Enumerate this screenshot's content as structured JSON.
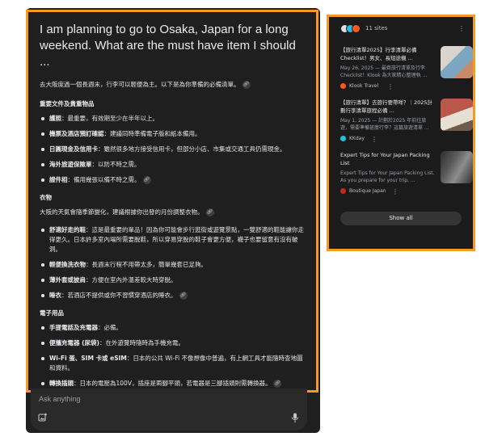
{
  "question": "I am planning to go to Osaka, Japan for a long weekend. What are the must have item I should ...",
  "intro": "去大阪度過一個長週末，行李可以輕便為主。以下是為你準備的必備清單。",
  "sections": {
    "documents": {
      "heading": "重要文件及貴重物品",
      "items": [
        {
          "term": "護照",
          "text": "：最重要，有效期至少在半年以上。"
        },
        {
          "term": "機票及酒店預訂確認",
          "text": "：建議同時準備電子版和紙本備用。"
        },
        {
          "term": "日圓現金及信用卡",
          "text": "：雖然很多地方接受信用卡，但部分小店、市集或交通工具仍需現金。"
        },
        {
          "term": "海外旅遊保險單",
          "text": "：以防不時之需。"
        },
        {
          "term": "證件相",
          "text": "：備用幾張以備不時之需。"
        }
      ]
    },
    "clothing": {
      "heading": "衣物",
      "intro": "大阪的天氣會隨季節變化，建議根據你出發的月份調整衣物。",
      "items": [
        {
          "term": "舒適好走的鞋",
          "text": "：這是最重要的單品！因為你可能會步行逛街或遊覽景點，一雙舒適的鞋能讓你走得更久。日本許多室內場所需要脫鞋，所以穿易穿脫的鞋子會更方便，襪子也要留意有沒有破洞。"
        },
        {
          "term": "輕便換洗衣物",
          "text": "：長週末行程不用帶太多，簡單幾套已足夠。"
        },
        {
          "term": "薄外套或披肩",
          "text": "：方便在室內外溫差較大時穿脫。"
        },
        {
          "term": "睡衣",
          "text": "：若酒店不提供或你不習慣穿酒店的睡衣。"
        }
      ]
    },
    "electronics": {
      "heading": "電子用品",
      "items": [
        {
          "term": "手提電話及充電器",
          "text": "：必備。"
        },
        {
          "term": "便攜充電器 (尿袋)",
          "text": "：在外遊覽時隨時為手機充電。"
        },
        {
          "term": "Wi-Fi 蛋、SIM 卡或 eSIM",
          "text": "：日本的公共 Wi-Fi 不像想像中普遍，有上網工具才能隨時查地圖和資料。"
        },
        {
          "term": "轉換插頭",
          "text": "：日本的電壓為100V，插座是兩腳平頭，若電器是三腳插頭則需轉換器。"
        }
      ]
    }
  },
  "input": {
    "placeholder": "Ask anything"
  },
  "sources": {
    "count_label": "11 sites",
    "items": [
      {
        "title": "【旅行清單2025】行李清單必備Checklist！男女、長短途機 ...",
        "snippet": "May 26, 2025 — 最齊旅行清單及行李Checklist！Klook 為大家精心整理執 ...",
        "site": "Klook Travel",
        "site_color": "#ff5722",
        "thumb_colors": [
          "#d9d4cc",
          "#7aa6c2",
          "#c98a6a"
        ]
      },
      {
        "title": "【旅行清單】去旅行要帶咩？｜2025計劃行李清單旅程必備 ...",
        "snippet": "May 1, 2025 — 計劃於2025 年前往旅遊，需要準備甚麼行李？這篇旅遊清單 ...",
        "site": "KKday",
        "site_color": "#26bfe0",
        "thumb_colors": [
          "#b9574a",
          "#e6dfd3",
          "#6f5b4c"
        ]
      },
      {
        "title": "Expert Tips for Your Japan Packing List",
        "snippet": "Expert Tips for Your Japan Packing List. As you prepare for your trip, ...",
        "site": "Boutique Japan",
        "site_color": "#c62828",
        "thumb_colors": [
          "#5a5a5a",
          "#8d8d8d",
          "#2e2e2e"
        ]
      }
    ],
    "show_all_label": "Show all"
  }
}
